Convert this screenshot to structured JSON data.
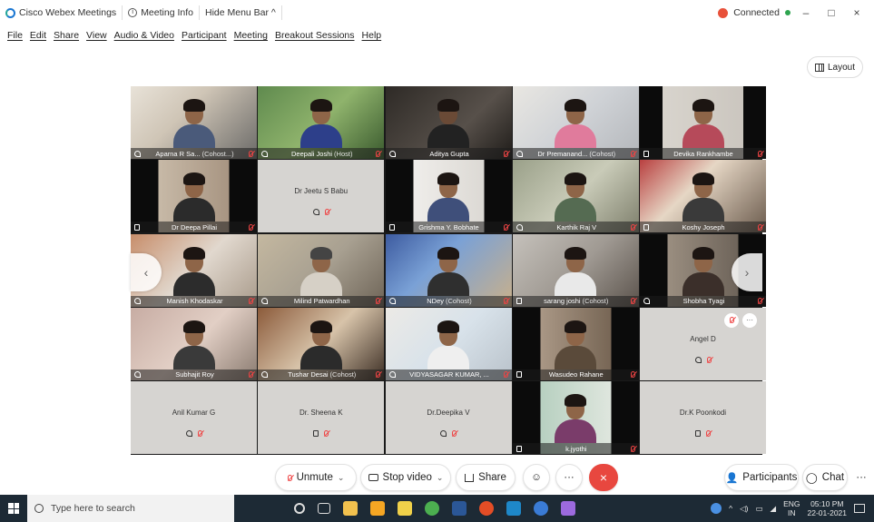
{
  "window": {
    "app_title": "Cisco Webex Meetings",
    "meeting_info": "Meeting Info",
    "hide_menu": "Hide Menu Bar ^",
    "status": "Connected",
    "min": "–",
    "max": "□",
    "close": "×"
  },
  "menu": [
    "File",
    "Edit",
    "Share",
    "View",
    "Audio & Video",
    "Participant",
    "Meeting",
    "Breakout Sessions",
    "Help"
  ],
  "layout_label": "Layout",
  "tiles": [
    {
      "name": "Aparna R Sa...",
      "role": "(Cohost...)"
    },
    {
      "name": "Deepali Joshi",
      "role": "(Host)"
    },
    {
      "name": "Aditya Gupta",
      "role": ""
    },
    {
      "name": "Dr Premanand...",
      "role": "(Cohost)"
    },
    {
      "name": "Devika Rankhambe",
      "role": ""
    },
    {
      "name": "Dr Deepa Pillai",
      "role": ""
    },
    {
      "name": "Dr Jeetu S Babu",
      "role": ""
    },
    {
      "name": "Grishma Y. Bobhate",
      "role": ""
    },
    {
      "name": "Karthik Raj V",
      "role": ""
    },
    {
      "name": "Koshy Joseph",
      "role": ""
    },
    {
      "name": "Manish Khodaskar",
      "role": ""
    },
    {
      "name": "Milind Patwardhan",
      "role": ""
    },
    {
      "name": "NDey",
      "role": "(Cohost)"
    },
    {
      "name": "sarang joshi",
      "role": "(Cohost)"
    },
    {
      "name": "Shobha Tyagi",
      "role": ""
    },
    {
      "name": "Subhajit Roy",
      "role": ""
    },
    {
      "name": "Tushar Desai",
      "role": "(Cohost)"
    },
    {
      "name": "VIDYASAGAR KUMAR, ...",
      "role": ""
    },
    {
      "name": "Wasudeo Rahane",
      "role": ""
    },
    {
      "name": "Angel D",
      "role": ""
    },
    {
      "name": "Anil Kumar G",
      "role": ""
    },
    {
      "name": "Dr. Sheena K",
      "role": ""
    },
    {
      "name": "Dr.Deepika V",
      "role": ""
    },
    {
      "name": "k.jyothi",
      "role": ""
    },
    {
      "name": "Dr.K Poonkodi",
      "role": ""
    }
  ],
  "controls": {
    "unmute": "Unmute",
    "stop_video": "Stop video",
    "share": "Share",
    "participants": "Participants",
    "chat": "Chat",
    "more": "···",
    "leave": "×"
  },
  "taskbar": {
    "search_placeholder": "Type here to search",
    "lang_top": "ENG",
    "lang_bottom": "IN",
    "time": "05:10 PM",
    "date": "22-01-2021"
  },
  "colors": {
    "accent": "#1976d2",
    "leave": "#e8473f",
    "taskbar": "#1d2a35"
  }
}
